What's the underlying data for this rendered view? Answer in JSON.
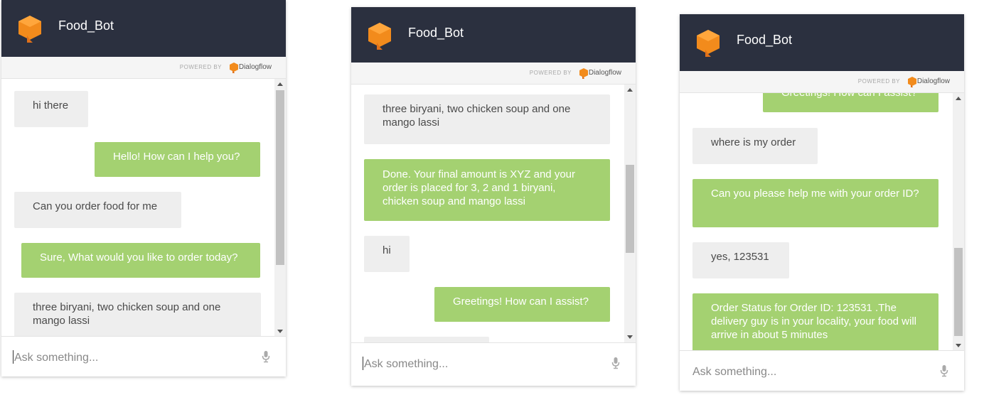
{
  "brand": {
    "accent": "#a4d171",
    "header_bg": "#2b303f",
    "logo_color": "#f28b1c"
  },
  "widgets": [
    {
      "title": "Food_Bot",
      "powered_by": "POWERED BY",
      "provider": "Dialogflow",
      "input_placeholder": "Ask something...",
      "messages": [
        {
          "from": "user",
          "text": "hi there"
        },
        {
          "from": "bot",
          "text": "Hello! How can I help you?"
        },
        {
          "from": "user",
          "text": "Can you order food for me"
        },
        {
          "from": "bot",
          "text": "Sure, What would you like to order today?"
        },
        {
          "from": "user",
          "text": "three biryani, two chicken soup and one mango lassi"
        }
      ]
    },
    {
      "title": "Food_Bot",
      "powered_by": "POWERED BY",
      "provider": "Dialogflow",
      "input_placeholder": "Ask something...",
      "messages": [
        {
          "from": "user",
          "text": "three biryani, two chicken soup and one mango lassi"
        },
        {
          "from": "bot",
          "text": "Done. Your final amount is XYZ and your order is placed for 3, 2 and 1 biryani, chicken soup and mango lassi"
        },
        {
          "from": "user",
          "text": "hi"
        },
        {
          "from": "bot",
          "text": "Greetings! How can I assist?"
        }
      ]
    },
    {
      "title": "Food_Bot",
      "powered_by": "POWERED BY",
      "provider": "Dialogflow",
      "input_placeholder": "Ask something...",
      "messages": [
        {
          "from": "bot",
          "text": "Greetings! How can I assist?"
        },
        {
          "from": "user",
          "text": "where is my order"
        },
        {
          "from": "bot",
          "text": "Can you please help me with your order ID?"
        },
        {
          "from": "user",
          "text": "yes, 123531"
        },
        {
          "from": "bot",
          "text": "Order Status for Order ID: 123531 .The delivery guy is in your locality, your food will arrive in about 5 minutes"
        }
      ]
    }
  ]
}
